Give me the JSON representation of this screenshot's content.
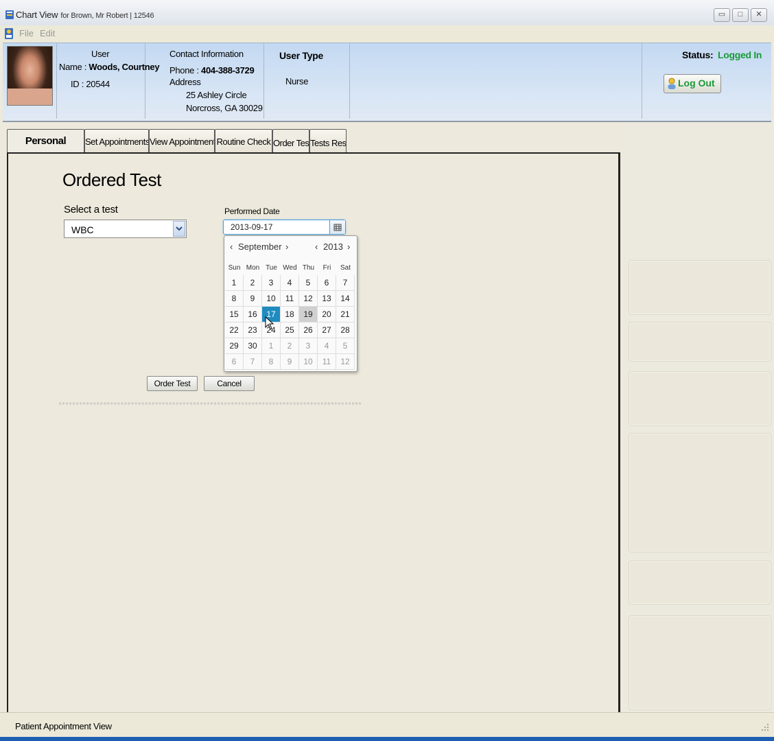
{
  "window": {
    "title": "Chart View",
    "subtitle": "for Brown, Mr Robert | 12546",
    "minimize_label": "▭",
    "maximize_label": "□",
    "close_label": "✕"
  },
  "menu": {
    "file": "File",
    "edit": "Edit"
  },
  "header": {
    "user_heading": "User",
    "name_label": "Name : ",
    "name_value": "Woods, Courtney",
    "id_label": "ID : 20544",
    "contact_heading": "Contact Information",
    "phone_label": "Phone : ",
    "phone_value": "404-388-3729",
    "address_label": "Address",
    "address_line1": "25 Ashley Circle",
    "address_line2": "Norcross, GA 30029",
    "user_type_heading": "User Type",
    "user_type_value": "Nurse",
    "status_label": "Status:",
    "status_value": "Logged In",
    "logout_label": "Log Out"
  },
  "tabs": [
    {
      "label": "Personal"
    },
    {
      "label": "Set Appointments"
    },
    {
      "label": "View Appointments"
    },
    {
      "label": "Routine Check"
    },
    {
      "label": "Order Tests"
    },
    {
      "label": "Tests Results"
    }
  ],
  "form": {
    "title": "Ordered Test",
    "select_label": "Select a test",
    "select_value": "WBC",
    "date_label": "Performed Date",
    "date_value": "2013-09-17",
    "order_button": "Order Test",
    "cancel_button": "Cancel"
  },
  "calendar": {
    "month": "September",
    "year": "2013",
    "prev": "‹",
    "next": "›",
    "weekdays": [
      "Sun",
      "Mon",
      "Tue",
      "Wed",
      "Thu",
      "Fri",
      "Sat"
    ],
    "weeks": [
      [
        "1",
        "2",
        "3",
        "4",
        "5",
        "6",
        "7"
      ],
      [
        "8",
        "9",
        "10",
        "11",
        "12",
        "13",
        "14"
      ],
      [
        "15",
        "16",
        "17",
        "18",
        "19",
        "20",
        "21"
      ],
      [
        "22",
        "23",
        "24",
        "25",
        "26",
        "27",
        "28"
      ],
      [
        "29",
        "30",
        "1",
        "2",
        "3",
        "4",
        "5"
      ],
      [
        "6",
        "7",
        "8",
        "9",
        "10",
        "11",
        "12"
      ]
    ],
    "selected_day": "17",
    "highlighted_day": "19"
  },
  "statusbar": {
    "text": "Patient Appointment View"
  },
  "colors": {
    "accent": "#1f8cc0",
    "status_green": "#1a9a38",
    "header_blue": "#c3d9f2"
  }
}
